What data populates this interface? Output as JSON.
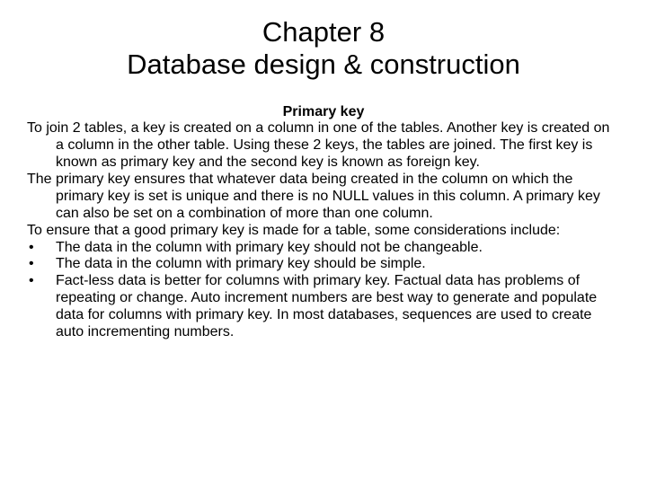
{
  "title_line1": "Chapter 8",
  "title_line2": "Database design & construction",
  "section_heading": "Primary key",
  "paragraphs": [
    "To join 2 tables, a key is created on a column in one of the tables. Another key is created on a column in the other table. Using these 2 keys, the tables are joined. The first key is known as primary key and the second key is known as foreign key.",
    "The primary key ensures that whatever data being created in the column on which the primary key is set is unique and there is no NULL values in this column. A primary key can also be set on a combination of more than one column.",
    "To ensure that a good primary key is made for a table, some considerations include:"
  ],
  "bullets": [
    "The data in the column with primary key should not be changeable.",
    "The data in the column with primary key should be simple.",
    "Fact-less data is better for columns with primary key. Factual data has problems of repeating or change. Auto increment numbers are best way to generate and populate data for columns with primary key. In most databases, sequences are used to create auto incrementing numbers."
  ],
  "bullet_mark": "•"
}
